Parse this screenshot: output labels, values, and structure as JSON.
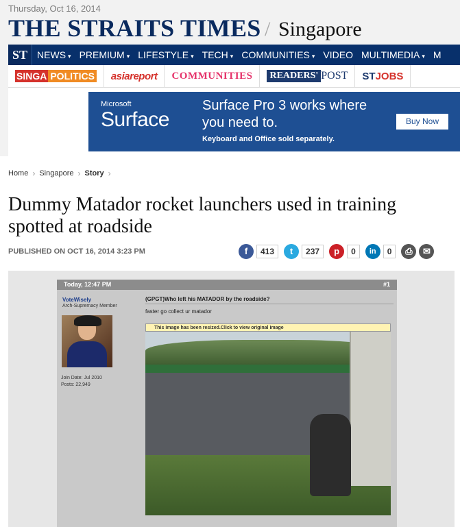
{
  "masthead": {
    "date": "Thursday, Oct 16, 2014",
    "title": "THE STRAITS TIMES",
    "slash": "/",
    "section": "Singapore"
  },
  "nav": {
    "logo": "ST",
    "items": [
      "NEWS",
      "PREMIUM",
      "LIFESTYLE",
      "TECH",
      "COMMUNITIES",
      "VIDEO",
      "MULTIMEDIA",
      "M"
    ],
    "caret": "▾"
  },
  "subnav": {
    "singapolitics_a": "SINGA",
    "singapolitics_b": "POLITICS",
    "asiareport": "asiareport",
    "communities": "COMMUNITIES",
    "readers": "READERS'",
    "post": "POST",
    "stjobs_st": "ST",
    "stjobs_jobs": "JOBS"
  },
  "ad": {
    "brand_small": "Microsoft",
    "brand": "Surface",
    "headline": "Surface Pro 3 works where you need to.",
    "note": "Keyboard and Office sold separately.",
    "cta": "Buy Now"
  },
  "breadcrumb": [
    "Home",
    "Singapore",
    "Story"
  ],
  "breadcrumb_sep": "›",
  "article": {
    "headline": "Dummy Matador rocket launchers used in training spotted at roadside",
    "published": "PUBLISHED ON OCT 16, 2014 3:23 PM"
  },
  "social": {
    "facebook_count": "413",
    "twitter_count": "237",
    "pinterest_count": "0",
    "linkedin_count": "0",
    "fb_glyph": "f",
    "tw_glyph": "t",
    "pi_glyph": "p",
    "li_glyph": "in",
    "print_glyph": "⎙",
    "email_glyph": "✉"
  },
  "forum": {
    "header_time": "Today, 12:47 PM",
    "post_number": "#1",
    "username": "VoteWisely",
    "rank": "Arch-Supremacy Member",
    "join_date": "Join Date: Jul 2010",
    "posts": "Posts: 22,949",
    "post_title": "(GPGT)Who left his MATADOR by the roadside?",
    "post_text": "faster go collect ur matador",
    "resize_notice": "This image has been resized.Click to view original image"
  }
}
